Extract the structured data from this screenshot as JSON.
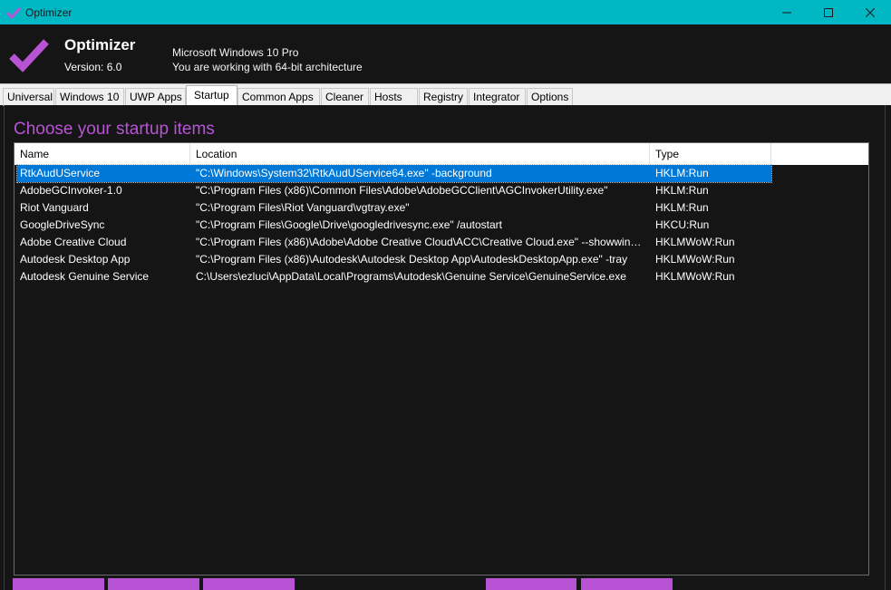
{
  "window": {
    "title": "Optimizer",
    "controls": [
      "minimize-icon",
      "maximize-icon",
      "close-icon"
    ]
  },
  "header": {
    "app_name": "Optimizer",
    "version": "Version: 6.0",
    "os": "Microsoft Windows 10 Pro",
    "arch": "You are working with 64-bit architecture",
    "logo_icon": "checkmark-icon"
  },
  "tabs": [
    {
      "label": "Universal"
    },
    {
      "label": "Windows 10"
    },
    {
      "label": "UWP Apps"
    },
    {
      "label": "Startup"
    },
    {
      "label": "Common Apps"
    },
    {
      "label": "Cleaner"
    },
    {
      "label": "Hosts"
    },
    {
      "label": "Registry"
    },
    {
      "label": "Integrator"
    },
    {
      "label": "Options"
    }
  ],
  "active_tab": "Startup",
  "startup": {
    "title": "Choose your startup items",
    "columns": [
      "Name",
      "Location",
      "Type"
    ],
    "rows": [
      {
        "name": "RtkAudUService",
        "location": "\"C:\\Windows\\System32\\RtkAudUService64.exe\" -background",
        "type": "HKLM:Run",
        "selected": true
      },
      {
        "name": "AdobeGCInvoker-1.0",
        "location": "\"C:\\Program Files (x86)\\Common Files\\Adobe\\AdobeGCClient\\AGCInvokerUtility.exe\"",
        "type": "HKLM:Run"
      },
      {
        "name": "Riot Vanguard",
        "location": "\"C:\\Program Files\\Riot Vanguard\\vgtray.exe\"",
        "type": "HKLM:Run"
      },
      {
        "name": "GoogleDriveSync",
        "location": "\"C:\\Program Files\\Google\\Drive\\googledrivesync.exe\" /autostart",
        "type": "HKCU:Run"
      },
      {
        "name": "Adobe Creative Cloud",
        "location": "\"C:\\Program Files (x86)\\Adobe\\Adobe Creative Cloud\\ACC\\Creative Cloud.exe\" --showwind...",
        "type": "HKLMWoW:Run"
      },
      {
        "name": "Autodesk Desktop App",
        "location": "\"C:\\Program Files (x86)\\Autodesk\\Autodesk Desktop App\\AutodeskDesktopApp.exe\" -tray",
        "type": "HKLMWoW:Run"
      },
      {
        "name": "Autodesk Genuine Service",
        "location": "C:\\Users\\ezluci\\AppData\\Local\\Programs\\Autodesk\\Genuine Service\\GenuineService.exe",
        "type": "HKLMWoW:Run"
      }
    ]
  },
  "colors": {
    "titlebar": "#00b7c3",
    "accent": "#b953d6",
    "background": "#151515",
    "selection": "#0078d7"
  }
}
